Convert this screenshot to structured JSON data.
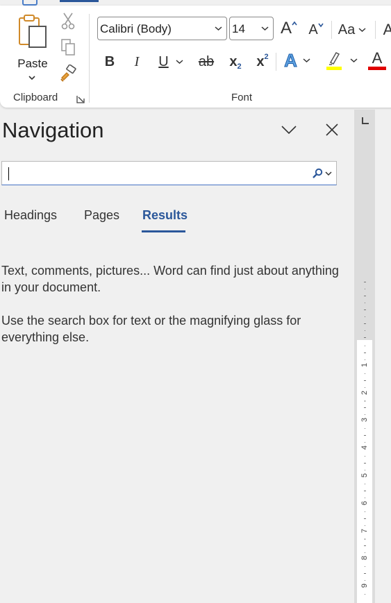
{
  "ribbon": {
    "clipboard": {
      "paste_label": "Paste",
      "group_label": "Clipboard",
      "cut_icon": "scissors-icon",
      "copy_icon": "copy-icon",
      "format_painter_icon": "paintbrush-icon"
    },
    "font": {
      "group_label": "Font",
      "font_name": "Calibri (Body)",
      "font_size": "14",
      "grow_label": "A",
      "shrink_label": "A",
      "change_case_label": "Aa",
      "bold_label": "B",
      "italic_label": "I",
      "underline_label": "U",
      "strike_label": "ab",
      "subscript_label": "x",
      "subscript_mark": "2",
      "superscript_label": "x",
      "superscript_mark": "2",
      "text_effects_label": "A",
      "font_color_label": "A",
      "highlight_color": "#ffff00",
      "font_color": "#e00000"
    }
  },
  "navigation": {
    "title": "Navigation",
    "search_placeholder": "",
    "tabs": [
      {
        "label": "Headings",
        "active": false
      },
      {
        "label": "Pages",
        "active": false
      },
      {
        "label": "Results",
        "active": true
      }
    ],
    "message_1": "Text, comments, pictures... Word can find just about anything in your document.",
    "message_2": "Use the search box for text or the magnifying glass for everything else."
  },
  "ruler": {
    "numbers": [
      "1",
      "2",
      "3",
      "4",
      "5",
      "6",
      "7",
      "8",
      "9"
    ]
  },
  "colors": {
    "accent": "#2b579a",
    "ribbon_bg": "#ffffff",
    "pane_bg": "#f0f0f0"
  }
}
